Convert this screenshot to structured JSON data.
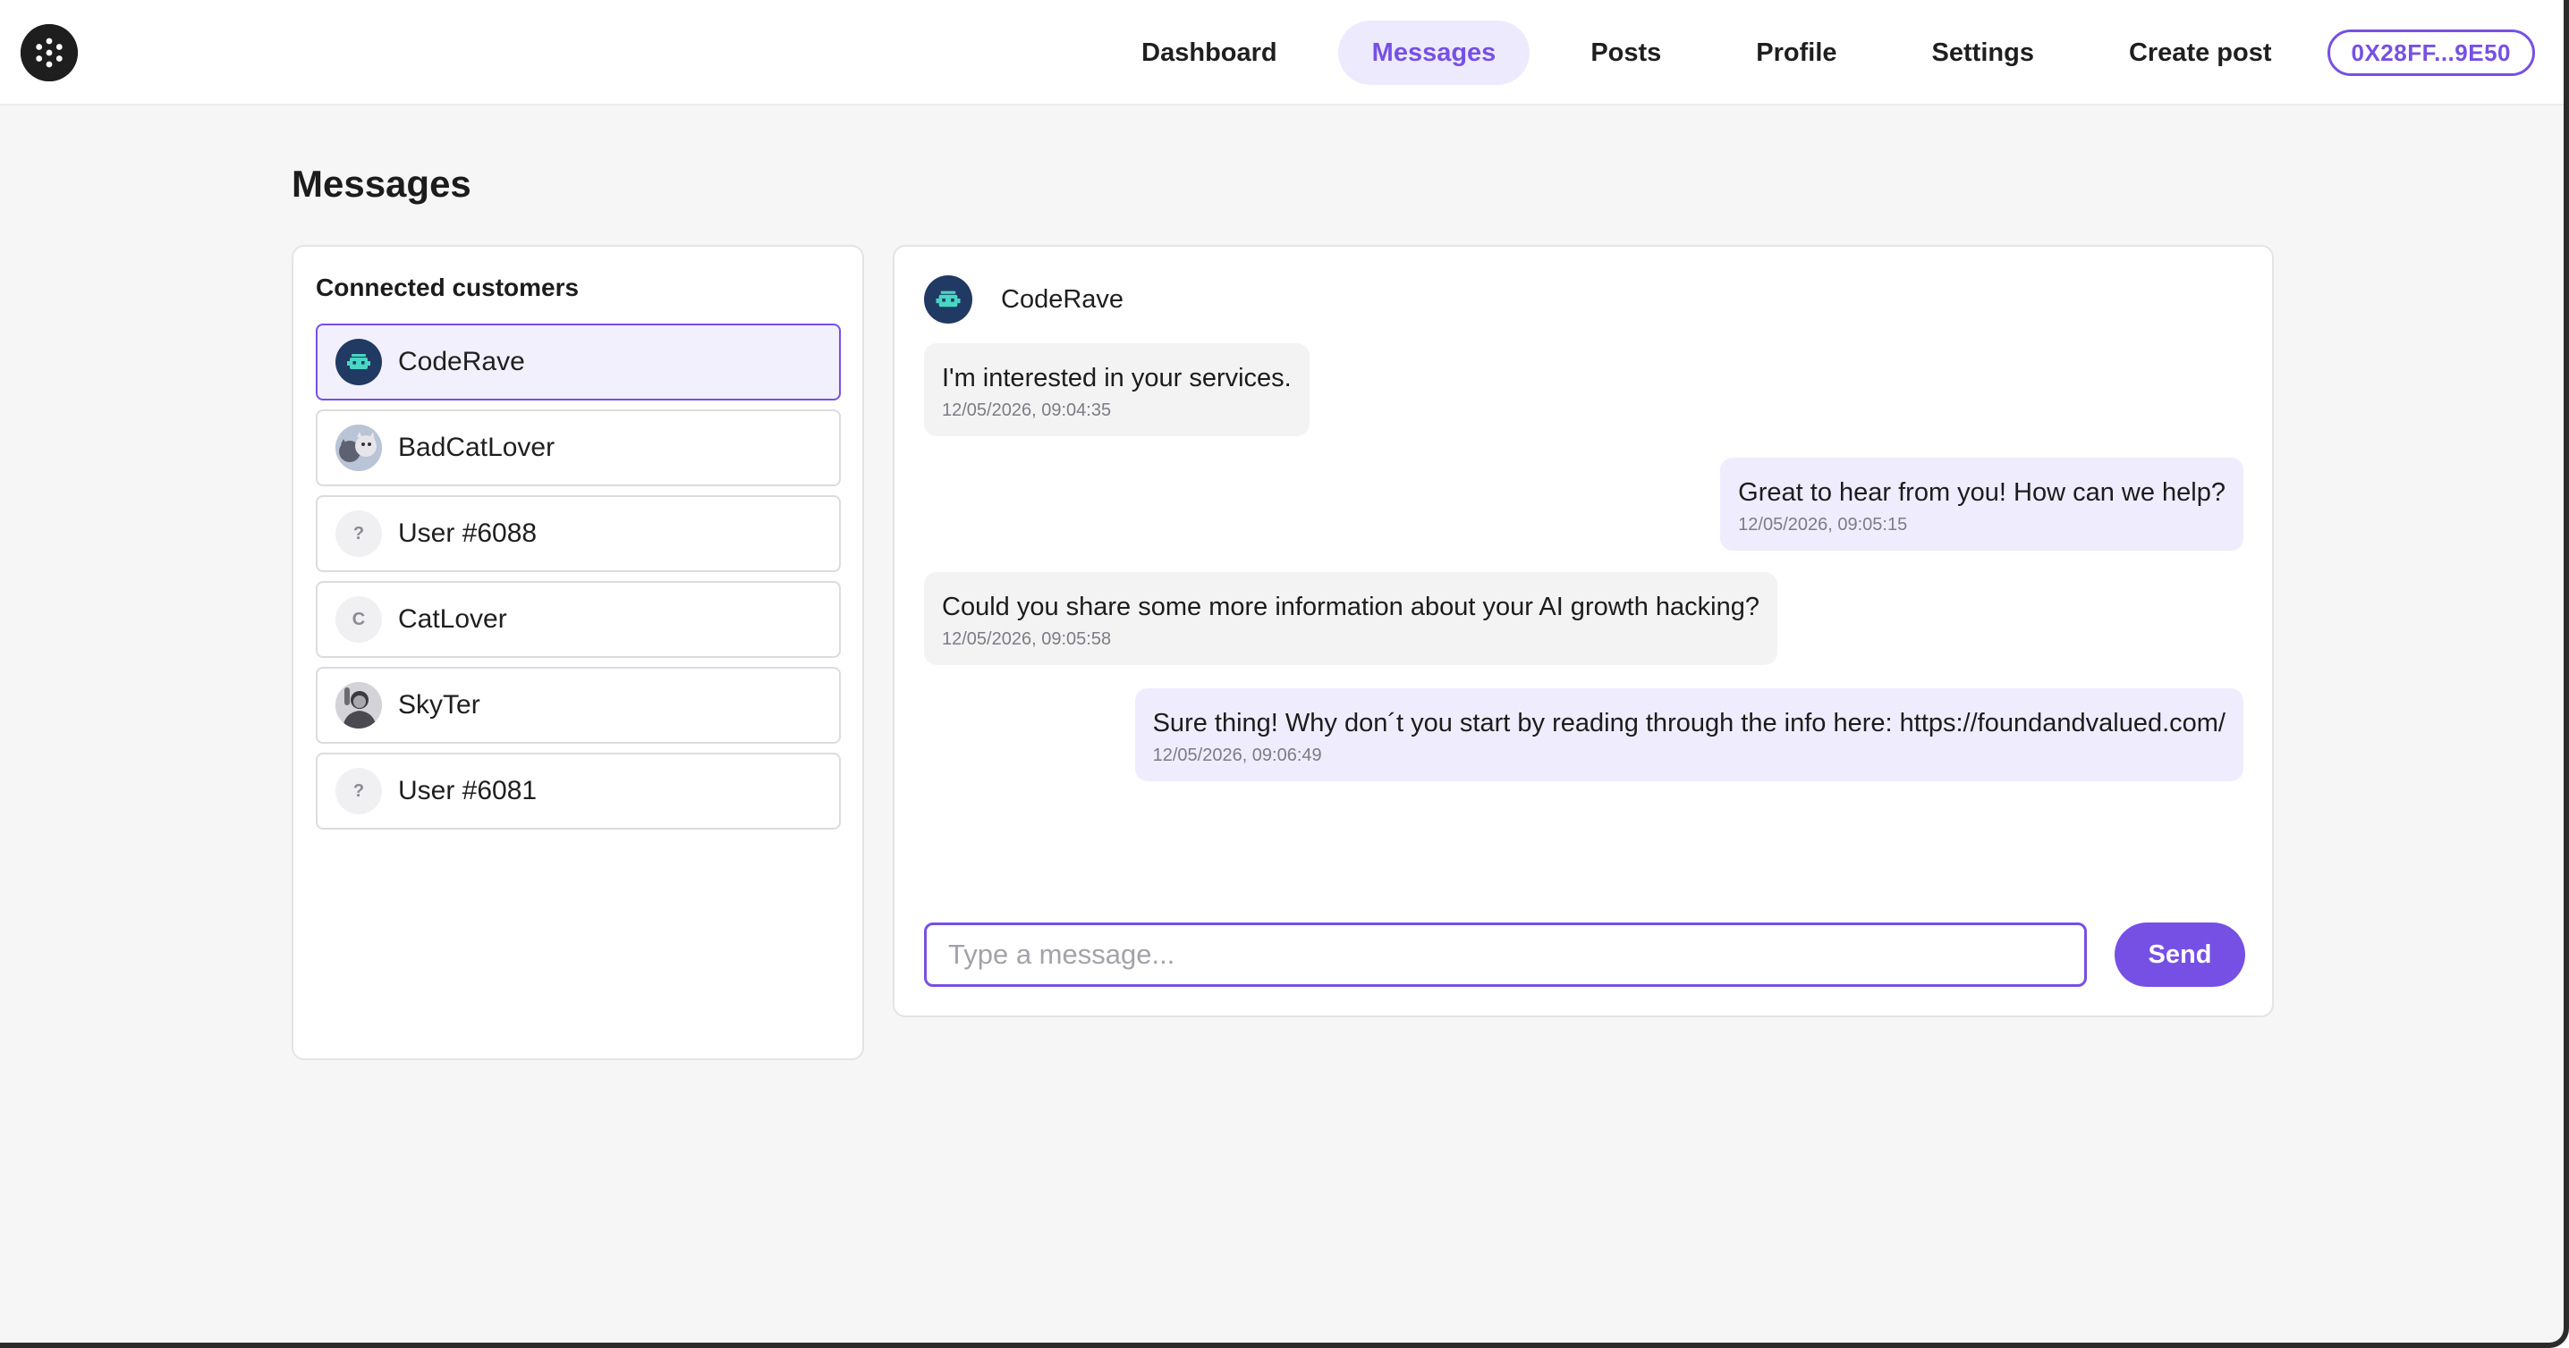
{
  "nav": {
    "items": [
      {
        "label": "Dashboard",
        "active": false
      },
      {
        "label": "Messages",
        "active": true
      },
      {
        "label": "Posts",
        "active": false
      },
      {
        "label": "Profile",
        "active": false
      },
      {
        "label": "Settings",
        "active": false
      },
      {
        "label": "Create post",
        "active": false
      }
    ],
    "wallet": "0X28FF...9E50"
  },
  "page": {
    "title": "Messages"
  },
  "customers": {
    "title": "Connected customers",
    "items": [
      {
        "name": "CodeRave",
        "avatar": "robot-icon",
        "active": true
      },
      {
        "name": "BadCatLover",
        "avatar": "photo-icon",
        "active": false
      },
      {
        "name": "User #6088",
        "avatar": "?",
        "active": false
      },
      {
        "name": "CatLover",
        "avatar": "C",
        "active": false
      },
      {
        "name": "SkyTer",
        "avatar": "photo-icon",
        "active": false
      },
      {
        "name": "User #6081",
        "avatar": "?",
        "active": false
      }
    ]
  },
  "chat": {
    "contact": "CodeRave",
    "messages": [
      {
        "direction": "in",
        "text": "I'm interested in your services.",
        "time": "12/05/2026, 09:04:35"
      },
      {
        "direction": "out",
        "text": "Great to hear from you! How can we help?",
        "time": "12/05/2026, 09:05:15"
      },
      {
        "direction": "in",
        "text": "Could you share some more information about your AI growth hacking?",
        "time": "12/05/2026, 09:05:58"
      },
      {
        "direction": "out",
        "text": "Sure thing! Why don´t you start by reading through the info here: https://foundandvalued.com/",
        "time": "12/05/2026, 09:06:49"
      }
    ],
    "input_placeholder": "Type a message...",
    "send_label": "Send"
  },
  "colors": {
    "accent": "#7650e4",
    "accent_light": "#eeeafd",
    "background": "#f6f6f7"
  }
}
